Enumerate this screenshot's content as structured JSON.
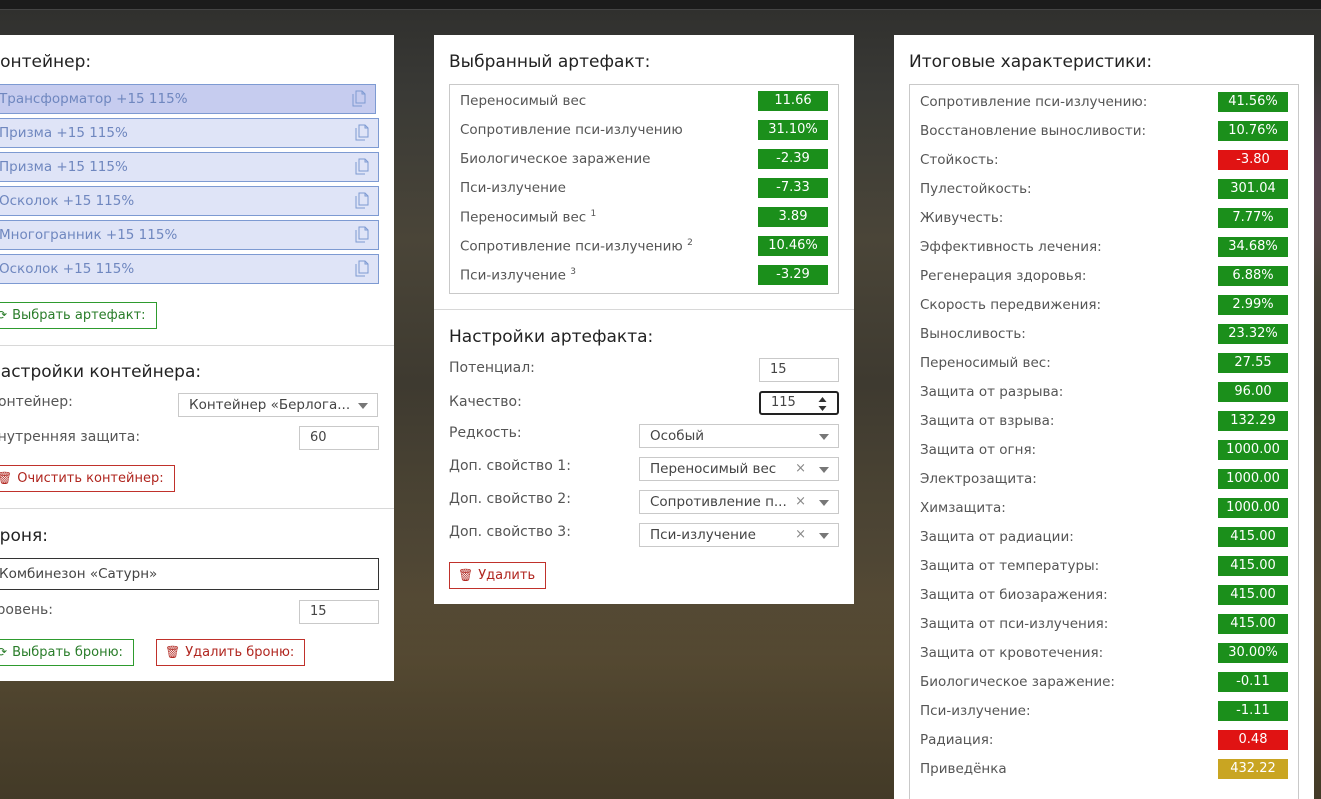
{
  "container_panel": {
    "title": "Контейнер:",
    "slots": [
      {
        "label": "Трансформатор +15 115%",
        "selected": true
      },
      {
        "label": "Призма +15 115%"
      },
      {
        "label": "Призма +15 115%"
      },
      {
        "label": "Осколок +15 115%"
      },
      {
        "label": "Многогранник +15 115%"
      },
      {
        "label": "Осколок +15 115%"
      }
    ],
    "choose_artifact_label": "Выбрать артефакт:",
    "settings_title": "Настройки контейнера:",
    "container_label": "Контейнер:",
    "container_value": "Контейнер «Берлога...",
    "inner_protection_label": "Внутренняя защита:",
    "inner_protection_value": "60",
    "clear_label": "Очистить контейнер:",
    "armor_title": "Броня:",
    "armor_value": "Комбинезон «Сатурн»",
    "level_label": "Уровень:",
    "level_value": "15",
    "choose_armor_label": "Выбрать броню:",
    "delete_armor_label": "Удалить броню:"
  },
  "artifact_panel": {
    "title": "Выбранный артефакт:",
    "stats": [
      {
        "name": "Переносимый вес",
        "sup": "",
        "value": "11.66",
        "color": "#1b8f1b"
      },
      {
        "name": "Сопротивление пси-излучению",
        "sup": "",
        "value": "31.10%",
        "color": "#1b8f1b"
      },
      {
        "name": "Биологическое заражение",
        "sup": "",
        "value": "-2.39",
        "color": "#1b8f1b"
      },
      {
        "name": "Пси-излучение",
        "sup": "",
        "value": "-7.33",
        "color": "#1b8f1b"
      },
      {
        "name": "Переносимый вес",
        "sup": "1",
        "value": "3.89",
        "color": "#1b8f1b"
      },
      {
        "name": "Сопротивление пси-излучению",
        "sup": "2",
        "value": "10.46%",
        "color": "#1b8f1b"
      },
      {
        "name": "Пси-излучение",
        "sup": "3",
        "value": "-3.29",
        "color": "#1b8f1b"
      }
    ],
    "settings_title": "Настройки артефакта:",
    "potential_label": "Потенциал:",
    "potential_value": "15",
    "quality_label": "Качество:",
    "quality_value": "115",
    "rarity_label": "Редкость:",
    "rarity_value": "Особый",
    "prop1_label": "Доп. свойство 1:",
    "prop1_value": "Переносимый вес",
    "prop2_label": "Доп. свойство 2:",
    "prop2_value": "Сопротивление п...",
    "prop3_label": "Доп. свойство 3:",
    "prop3_value": "Пси-излучение",
    "delete_label": "Удалить"
  },
  "totals_panel": {
    "title": "Итоговые характеристики:",
    "stats": [
      {
        "name": "Сопротивление пси-излучению:",
        "value": "41.56%",
        "color": "green"
      },
      {
        "name": "Восстановление выносливости:",
        "value": "10.76%",
        "color": "green"
      },
      {
        "name": "Стойкость:",
        "value": "-3.80",
        "color": "red"
      },
      {
        "name": "Пулестойкость:",
        "value": "301.04",
        "color": "green"
      },
      {
        "name": "Живучесть:",
        "value": "7.77%",
        "color": "green"
      },
      {
        "name": "Эффективность лечения:",
        "value": "34.68%",
        "color": "green"
      },
      {
        "name": "Регенерация здоровья:",
        "value": "6.88%",
        "color": "green"
      },
      {
        "name": "Скорость передвижения:",
        "value": "2.99%",
        "color": "green"
      },
      {
        "name": "Выносливость:",
        "value": "23.32%",
        "color": "green"
      },
      {
        "name": "Переносимый вес:",
        "value": "27.55",
        "color": "green"
      },
      {
        "name": "Защита от разрыва:",
        "value": "96.00",
        "color": "green"
      },
      {
        "name": "Защита от взрыва:",
        "value": "132.29",
        "color": "green"
      },
      {
        "name": "Защита от огня:",
        "value": "1000.00",
        "color": "green"
      },
      {
        "name": "Электрозащита:",
        "value": "1000.00",
        "color": "green"
      },
      {
        "name": "Химзащита:",
        "value": "1000.00",
        "color": "green"
      },
      {
        "name": "Защита от радиации:",
        "value": "415.00",
        "color": "green"
      },
      {
        "name": "Защита от температуры:",
        "value": "415.00",
        "color": "green"
      },
      {
        "name": "Защита от биозаражения:",
        "value": "415.00",
        "color": "green"
      },
      {
        "name": "Защита от пси-излучения:",
        "value": "415.00",
        "color": "green"
      },
      {
        "name": "Защита от кровотечения:",
        "value": "30.00%",
        "color": "green"
      },
      {
        "name": "Биологическое заражение:",
        "value": "-0.11",
        "color": "green"
      },
      {
        "name": "Пси-излучение:",
        "value": "-1.11",
        "color": "green"
      },
      {
        "name": "Радиация:",
        "value": "0.48",
        "color": "red"
      },
      {
        "name": "Приведёнка",
        "value": "432.22",
        "color": "yellow"
      }
    ]
  },
  "colors": {
    "green": "#1b8f1b",
    "red": "#e01313",
    "yellow": "#c9a522"
  }
}
